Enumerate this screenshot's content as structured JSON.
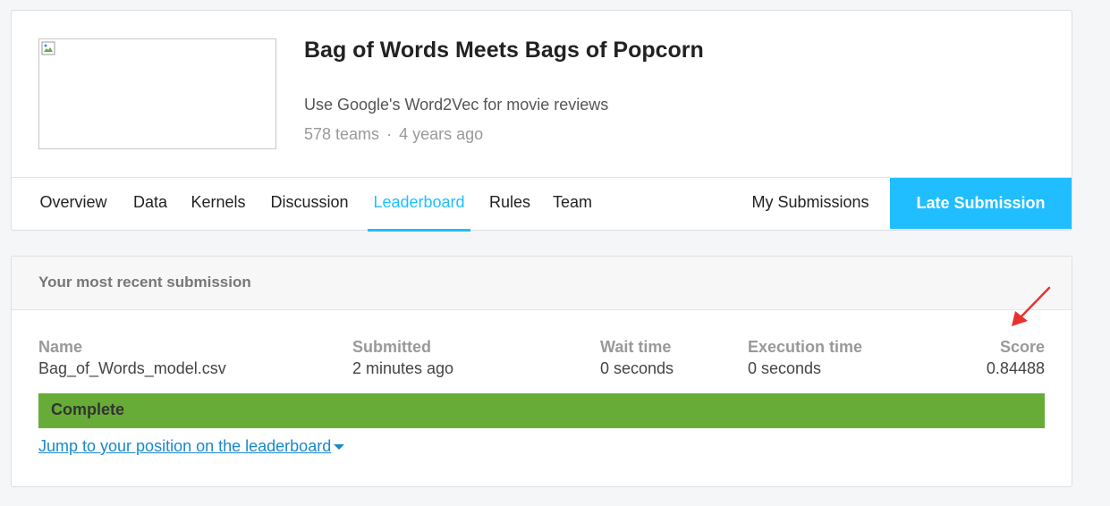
{
  "competition": {
    "title": "Bag of Words Meets Bags of Popcorn",
    "subtitle": "Use Google's Word2Vec for movie reviews",
    "teams": "578 teams",
    "separator": "·",
    "age": "4 years ago",
    "thumbnail_icon": "broken-image-icon"
  },
  "tabs": [
    {
      "label": "Overview",
      "active": false
    },
    {
      "label": "Data",
      "active": false
    },
    {
      "label": "Kernels",
      "active": false
    },
    {
      "label": "Discussion",
      "active": false
    },
    {
      "label": "Leaderboard",
      "active": true
    },
    {
      "label": "Rules",
      "active": false
    },
    {
      "label": "Team",
      "active": false
    }
  ],
  "my_submissions_label": "My Submissions",
  "late_submission_label": "Late Submission",
  "submission": {
    "header": "Your most recent submission",
    "columns": [
      {
        "label": "Name",
        "value": "Bag_of_Words_model.csv"
      },
      {
        "label": "Submitted",
        "value": "2 minutes ago"
      },
      {
        "label": "Wait time",
        "value": "0 seconds"
      },
      {
        "label": "Execution time",
        "value": "0 seconds"
      },
      {
        "label": "Score",
        "value": "0.84488"
      }
    ],
    "status": "Complete",
    "jump_link": "Jump to your position on the leaderboard"
  },
  "colors": {
    "accent": "#20beff",
    "status_complete": "#67ac37",
    "link": "#1a88c9",
    "annotation_arrow": "#e8322e"
  }
}
